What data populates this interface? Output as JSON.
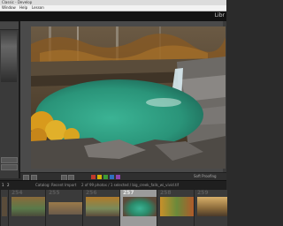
{
  "window": {
    "title": "Classic - Develop"
  },
  "menu": {
    "items": [
      "Window",
      "Help",
      "Lesson"
    ]
  },
  "module_label": "Libr",
  "toolbar": {
    "zoom_label": "Soft Proofing"
  },
  "filmbar": {
    "page1": "1",
    "page2": "2",
    "collection_label": "Catalog: Recent Import",
    "file_info": "2 of 99 photos / 1 selected / big_creek_falls_wi_vivid.tif",
    "filter_label": "Filter:"
  },
  "filmstrip": {
    "numbers": [
      "",
      "254",
      "255",
      "256",
      "257",
      "258",
      "259"
    ]
  },
  "icons": [
    "window-control-icon",
    "grid-icon",
    "compare-icon",
    "flag-icon",
    "star-icon",
    "color-label-icon"
  ],
  "colors": {
    "accent": "#9b9b9b",
    "background": "#2b2b2b",
    "id_plate": "#121212",
    "water": "#2fa586",
    "foliage": "#d89a1c"
  }
}
